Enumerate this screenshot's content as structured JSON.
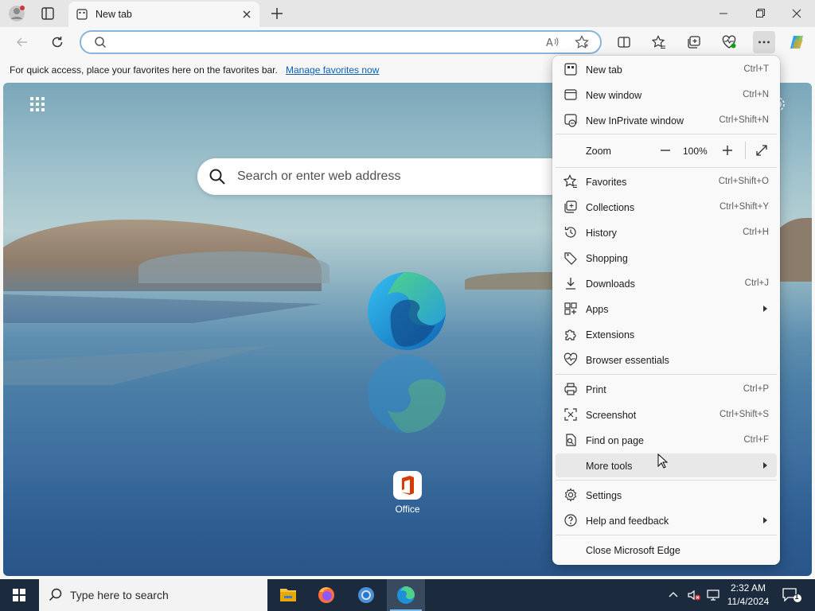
{
  "tab": {
    "title": "New tab"
  },
  "favorites_bar": {
    "message": "For quick access, place your favorites here on the favorites bar.",
    "link": "Manage favorites now"
  },
  "newtab_page": {
    "search_placeholder": "Search or enter web address",
    "shortcut_label": "Office"
  },
  "menu": {
    "items": [
      {
        "label": "New tab",
        "shortcut": "Ctrl+T",
        "icon": "new-tab-icon"
      },
      {
        "label": "New window",
        "shortcut": "Ctrl+N",
        "icon": "window-icon"
      },
      {
        "label": "New InPrivate window",
        "shortcut": "Ctrl+Shift+N",
        "icon": "inprivate-icon"
      },
      {
        "label": "Favorites",
        "shortcut": "Ctrl+Shift+O",
        "icon": "favorites-icon"
      },
      {
        "label": "Collections",
        "shortcut": "Ctrl+Shift+Y",
        "icon": "collections-icon"
      },
      {
        "label": "History",
        "shortcut": "Ctrl+H",
        "icon": "history-icon"
      },
      {
        "label": "Shopping",
        "shortcut": "",
        "icon": "tag-icon"
      },
      {
        "label": "Downloads",
        "shortcut": "Ctrl+J",
        "icon": "download-icon"
      },
      {
        "label": "Apps",
        "shortcut": "",
        "icon": "apps-icon",
        "submenu": true
      },
      {
        "label": "Extensions",
        "shortcut": "",
        "icon": "puzzle-icon"
      },
      {
        "label": "Browser essentials",
        "shortcut": "",
        "icon": "heart-pulse-icon"
      },
      {
        "label": "Print",
        "shortcut": "Ctrl+P",
        "icon": "printer-icon"
      },
      {
        "label": "Screenshot",
        "shortcut": "Ctrl+Shift+S",
        "icon": "screenshot-icon"
      },
      {
        "label": "Find on page",
        "shortcut": "Ctrl+F",
        "icon": "find-icon"
      },
      {
        "label": "More tools",
        "shortcut": "",
        "icon": "",
        "submenu": true,
        "hovered": true
      },
      {
        "label": "Settings",
        "shortcut": "",
        "icon": "gear-icon"
      },
      {
        "label": "Help and feedback",
        "shortcut": "",
        "icon": "help-icon",
        "submenu": true
      },
      {
        "label": "Close Microsoft Edge",
        "shortcut": "",
        "icon": ""
      }
    ],
    "zoom": {
      "label": "Zoom",
      "value": "100%"
    }
  },
  "taskbar": {
    "search_placeholder": "Type here to search",
    "time": "2:32 AM",
    "date": "11/4/2024",
    "notification_count": "1"
  },
  "colors": {
    "accent": "#0a5fb4",
    "taskbar": "#1c2a3e"
  }
}
